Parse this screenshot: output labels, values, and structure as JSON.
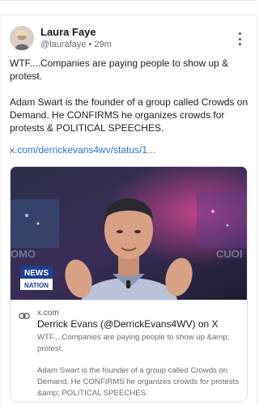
{
  "post": {
    "author_name": "Laura Faye",
    "author_handle": "@laurafaye",
    "separator": "•",
    "time_ago": "29m",
    "text_lines": [
      "WTF....Companies are paying people to show up & protest.",
      "Adam Swart is the founder of a group called Crowds on Demand. He CONFIRMS he organizes crowds for protests & POLITICAL SPEECHES."
    ],
    "link_text": "x.com/derrickevans4wv/status/1..."
  },
  "embed": {
    "domain": "x.com",
    "title": "Derrick Evans (@DerrickEvans4WV) on X",
    "desc_lines": [
      "WTF....Companies are paying people to show up &amp; protest.",
      "Adam Swart is the founder of a group called Crowds on Demand. He CONFIRMS he organizes crowds for protests &amp; POLITICAL SPEECHES."
    ],
    "image": {
      "logo_line1": "NEWS",
      "logo_line2": "NATION",
      "bg_text_left": "OMO",
      "bg_text_right": "CUOI"
    }
  },
  "icons": {
    "more": "more-vertical-icon",
    "link": "link-icon"
  }
}
